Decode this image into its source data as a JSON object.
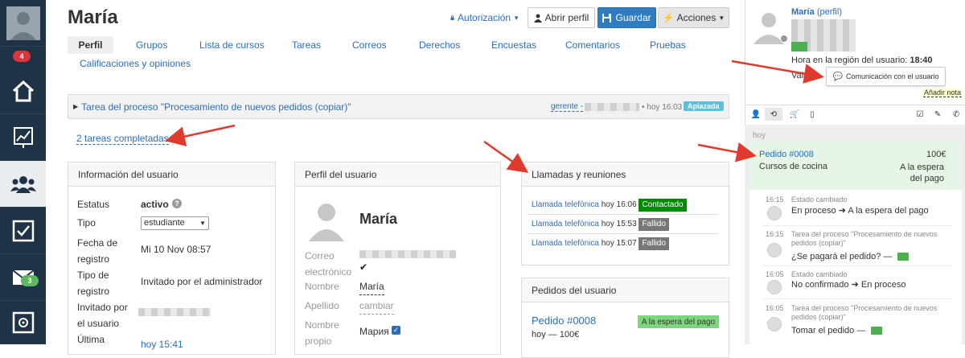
{
  "nav": {
    "profile_badge": "4",
    "mail_badge": "3"
  },
  "header": {
    "title": "María",
    "auth_label": "Autorización",
    "open_profile_label": "Abrir perfil",
    "save_label": "Guardar",
    "actions_label": "Acciones"
  },
  "tabs": [
    "Perfil",
    "Grupos",
    "Lista de cursos",
    "Tareas",
    "Correos",
    "Derechos",
    "Encuestas",
    "Comentarios",
    "Pruebas",
    "Calificaciones y opiniones"
  ],
  "task": {
    "title": "Tarea del proceso \"Procesamiento de nuevos pedidos (copiar)\"",
    "assignee": "gerente -",
    "time": "• hoy 16:03",
    "badge": "Aplazada"
  },
  "completed_tasks": "2 tareas completadas",
  "user_info": {
    "header": "Información del usuario",
    "status_label": "Estatus",
    "status_value": "activo",
    "type_label": "Tipo",
    "type_value": "estudiante",
    "reg_date_label": "Fecha de registro",
    "reg_date_value": "Mi 10 Nov 08:57",
    "reg_type_label": "Tipo de registro",
    "reg_type_value": "Invitado por el administrador",
    "invited_label": "Invitado por el usuario",
    "last_label": "Última",
    "last_value": "hoy 15:41"
  },
  "user_profile": {
    "header": "Perfil del usuario",
    "name_big": "María",
    "email_label": "Correo electrónico",
    "name_label": "Nombre",
    "name_value": "María",
    "surname_label": "Apellido",
    "surname_value": "cambiar",
    "own_name_label": "Nombre propio",
    "own_name_value": "Мария"
  },
  "calls": {
    "header": "Llamadas y reuniones",
    "items": [
      {
        "label": "Llamada telefónica",
        "time": "hoy 16:06",
        "status": "Contactado",
        "color": "#008a00"
      },
      {
        "label": "Llamada telefónica",
        "time": "hoy 15:53",
        "status": "Fallido",
        "color": "#777777"
      },
      {
        "label": "Llamada telefónica",
        "time": "hoy 15:07",
        "status": "Fallido",
        "color": "#777777"
      }
    ]
  },
  "orders": {
    "header": "Pedidos del usuario",
    "order_label": "Pedido #0008",
    "order_status": "A la espera del pago",
    "order_meta": "hoy — 100€"
  },
  "right": {
    "name": "María",
    "profile_link": "(perfil)",
    "region_time_label": "Hora en la región del usuario:",
    "region_time": "18:40",
    "city_prefix": "Valen",
    "comm_button": "Comunicación con el usuario",
    "add_note": "Añadir nota",
    "today": "hoy",
    "order_label": "Pedido #0008",
    "order_amount": "100€",
    "order_course": "Cursos de cocina",
    "order_status": "A la espera del pago",
    "feed": [
      {
        "time": "16:15",
        "small": "Estado cambiado",
        "text": "En proceso ➜ A la espera del pago"
      },
      {
        "time": "16:15",
        "small": "Tarea del proceso \"Procesamiento de nuevos pedidos (copiar)\"",
        "text": "¿Se pagará el pedido? —"
      },
      {
        "time": "16:05",
        "small": "Estado cambiado",
        "text": "No confirmado ➜ En proceso"
      },
      {
        "time": "16:05",
        "small": "Tarea del proceso \"Procesamiento de nuevos pedidos (copiar)\"",
        "text": "Tomar el pedido —"
      }
    ]
  },
  "colors": {
    "nav_bg": "#1f3246",
    "link": "#2a6ebb",
    "save": "#2f7dc0",
    "deferred": "#5bc0de",
    "arrow": "#e03a2f"
  }
}
